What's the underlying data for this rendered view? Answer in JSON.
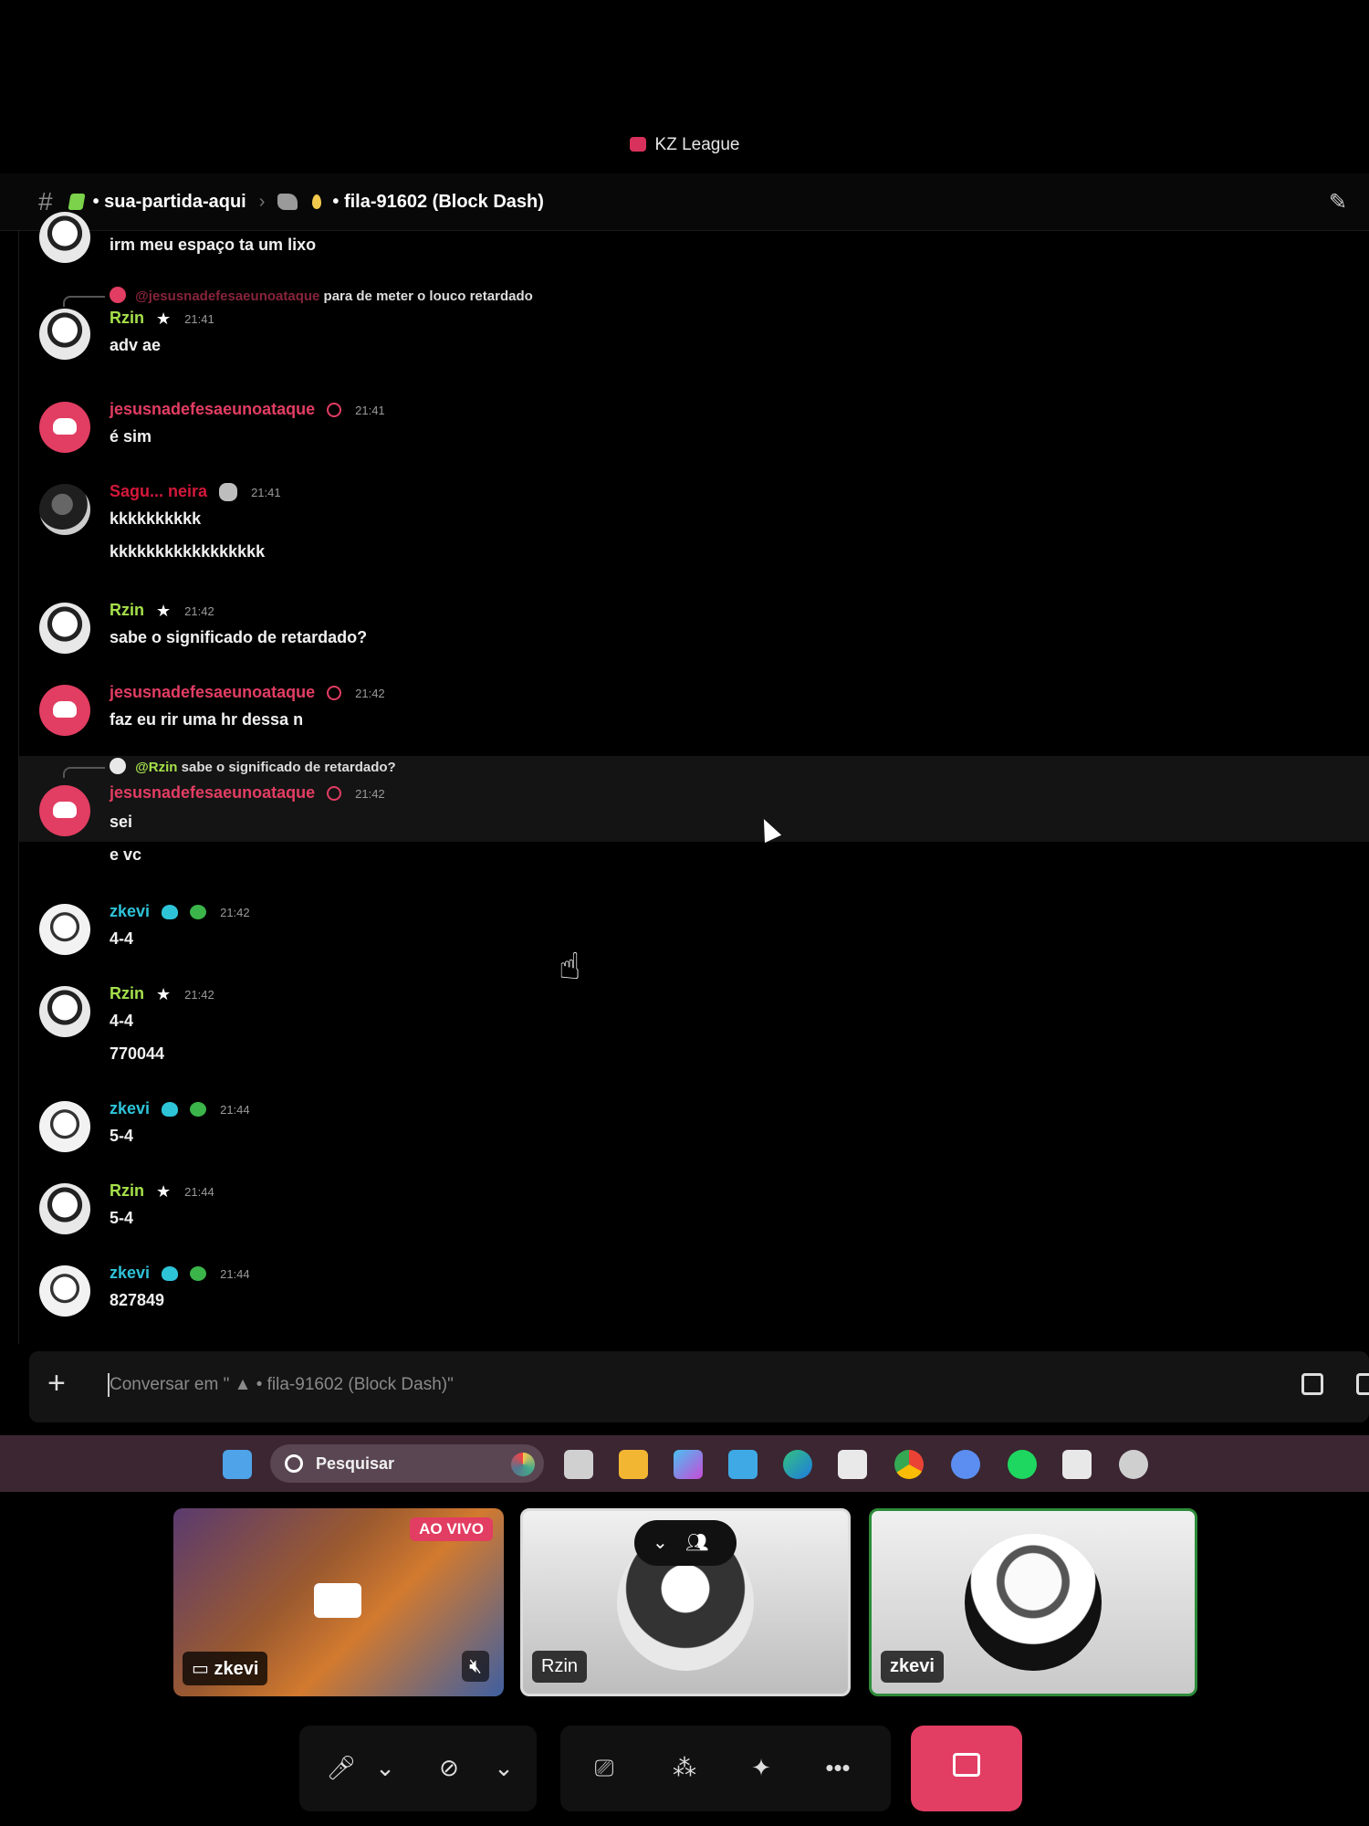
{
  "window": {
    "title": "KZ League"
  },
  "header": {
    "channel_path": [
      "sua-partida-aqui",
      "fila-91602 (Block Dash)"
    ]
  },
  "messages": [
    {
      "text": "irm meu espaço ta um lixo"
    },
    {
      "reply_mention": "@jesusnadefesaeunoataque",
      "reply_text": "para de meter o louco retardado",
      "author": "Rzin",
      "author_color": "#a6e04b",
      "time": "21:41",
      "lines": [
        "adv ae"
      ]
    },
    {
      "author": "jesusnadefesaeunoataque",
      "author_color": "#e23d62",
      "time": "21:41",
      "lines": [
        "é sim"
      ]
    },
    {
      "author": "Sagu... neira",
      "author_color": "#d4183a",
      "time": "21:41",
      "lines": [
        "kkkkkkkkkk",
        "kkkkkkkkkkkkkkkkk"
      ]
    },
    {
      "author": "Rzin",
      "author_color": "#a6e04b",
      "time": "21:42",
      "lines": [
        "sabe o significado de retardado?"
      ]
    },
    {
      "author": "jesusnadefesaeunoataque",
      "author_color": "#e23d62",
      "time": "21:42",
      "lines": [
        "faz eu rir uma hr dessa n"
      ]
    },
    {
      "reply_mention": "@Rzin",
      "reply_text": "sabe o significado de retardado?",
      "author": "jesusnadefesaeunoataque",
      "author_color": "#e23d62",
      "time": "21:42",
      "lines": [
        "sei",
        "e vc"
      ]
    },
    {
      "author": "zkevi",
      "author_color": "#2ec4d8",
      "time": "21:42",
      "lines": [
        "4-4"
      ]
    },
    {
      "author": "Rzin",
      "author_color": "#a6e04b",
      "time": "21:42",
      "lines": [
        "4-4",
        "770044"
      ]
    },
    {
      "author": "zkevi",
      "author_color": "#2ec4d8",
      "time": "21:44",
      "lines": [
        "5-4"
      ]
    },
    {
      "author": "Rzin",
      "author_color": "#a6e04b",
      "time": "21:44",
      "lines": [
        "5-4"
      ]
    },
    {
      "author": "zkevi",
      "author_color": "#2ec4d8",
      "time": "21:44",
      "lines": [
        "827849"
      ]
    }
  ],
  "composer": {
    "placeholder": "Conversar em \" ▲ • fila-91602 (Block Dash)\""
  },
  "taskbar": {
    "search_label": "Pesquisar"
  },
  "call": {
    "tiles": [
      {
        "name": "zkevi",
        "live_badge": "AO VIVO"
      },
      {
        "name": "Rzin"
      },
      {
        "name": "zkevi"
      }
    ]
  },
  "icons": {
    "header": [
      "hash-icon",
      "gem-icon",
      "rock-icon",
      "drop-icon",
      "pin-icon"
    ],
    "controls": [
      "microphone-icon",
      "chevron-down-icon",
      "camera-off-icon",
      "chevron-down-icon",
      "screen-share-icon",
      "activities-icon",
      "soundboard-icon",
      "more-icon",
      "leave-call-icon"
    ]
  }
}
